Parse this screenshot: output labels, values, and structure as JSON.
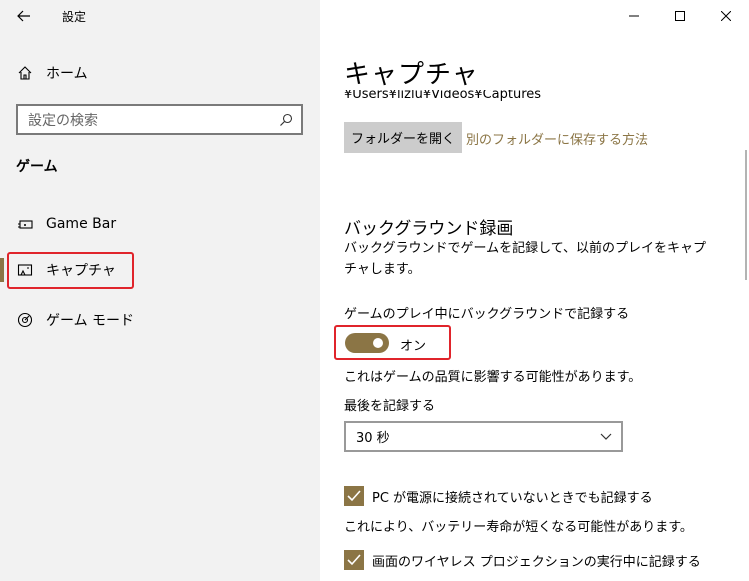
{
  "window": {
    "title": "設定"
  },
  "sidebar": {
    "home_label": "ホーム",
    "search_placeholder": "設定の検索",
    "section_heading": "ゲーム",
    "items": [
      {
        "label": "Game Bar",
        "icon": "game-bar-icon"
      },
      {
        "label": "キャプチャ",
        "icon": "capture-icon",
        "selected": true
      },
      {
        "label": "ゲーム モード",
        "icon": "game-mode-icon"
      }
    ]
  },
  "main": {
    "title": "キャプチャ",
    "path": "¥Users¥lizlu¥Videos¥Captures",
    "open_folder_button": "フォルダーを開く",
    "save_elsewhere_link": "別のフォルダーに保存する方法",
    "bg_recording": {
      "heading": "バックグラウンド録画",
      "description": "バックグラウンドでゲームを記録して、以前のプレイをキャプチャします。",
      "toggle_label": "ゲームのプレイ中にバックグラウンドで記録する",
      "toggle_state": "オン",
      "toggle_on": true,
      "quality_note": "これはゲームの品質に影響する可能性があります。",
      "record_last_label": "最後を記録する",
      "record_last_value": "30 秒",
      "checkbox_power": "PC が電源に接続されていないときでも記録する",
      "battery_note": "これにより、バッテリー寿命が短くなる可能性があります。",
      "checkbox_wireless": "画面のワイヤレス プロジェクションの実行中に記録する"
    }
  },
  "colors": {
    "accent": "#8b7545",
    "highlight_border": "#e0242b",
    "sidebar_bg": "#f2f2f2"
  }
}
